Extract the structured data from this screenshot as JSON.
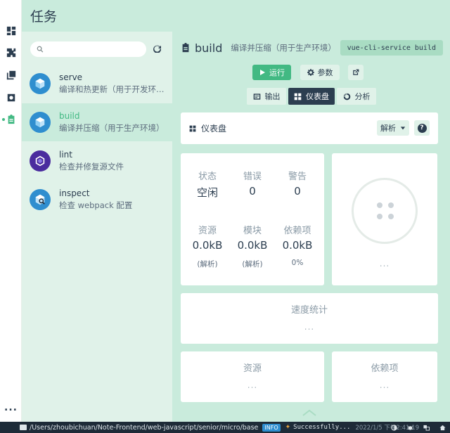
{
  "header": {
    "title": "任务"
  },
  "rail": {
    "icons": [
      "dashboard-icon",
      "plugin-icon",
      "dependencies-icon",
      "config-icon",
      "tasks-icon"
    ],
    "more": "..."
  },
  "search": {
    "placeholder": "",
    "value": ""
  },
  "tasks": [
    {
      "name": "serve",
      "desc": "编译和热更新（用于开发环境）",
      "icon": "vue-cube-icon"
    },
    {
      "name": "build",
      "desc": "编译并压缩（用于生产环境）",
      "icon": "vue-cube-icon"
    },
    {
      "name": "lint",
      "desc": "检查并修复源文件",
      "icon": "eslint-icon"
    },
    {
      "name": "inspect",
      "desc": "检查 webpack 配置",
      "icon": "inspect-icon"
    }
  ],
  "main": {
    "title": "build",
    "desc": "编译并压缩（用于生产环境）",
    "command": "vue-cli-service build",
    "run_label": "运行",
    "params_label": "参数",
    "tabs": {
      "output": "输出",
      "dashboard": "仪表盘",
      "analyze": "分析"
    },
    "dashboard_title": "仪表盘",
    "analyze_select": "解析",
    "help": "?"
  },
  "stats": {
    "status": {
      "label": "状态",
      "value": "空闲"
    },
    "errors": {
      "label": "错误",
      "value": "0"
    },
    "warnings": {
      "label": "警告",
      "value": "0"
    },
    "assets": {
      "label": "资源",
      "value": "0.0kB",
      "sub": "(解析)"
    },
    "modules": {
      "label": "模块",
      "value": "0.0kB",
      "sub": "(解析)"
    },
    "deps": {
      "label": "依赖项",
      "value": "0.0kB",
      "sub": "0%"
    }
  },
  "placeholder": "...",
  "speed": {
    "title": "速度统计"
  },
  "assets_block": {
    "title": "资源"
  },
  "deps_block": {
    "title": "依赖项"
  },
  "statusbar": {
    "path": "/Users/zhoubichuan/Note-Frontend/web-javascript/senior/micro/base",
    "level": "INFO",
    "message": "Successfully...",
    "time": "2022/1/5 下午2:41:19"
  },
  "colors": {
    "accent": "#42b983",
    "dark": "#2c3e50",
    "panel": "#e0f2e9",
    "bg": "#c9ebdc"
  }
}
